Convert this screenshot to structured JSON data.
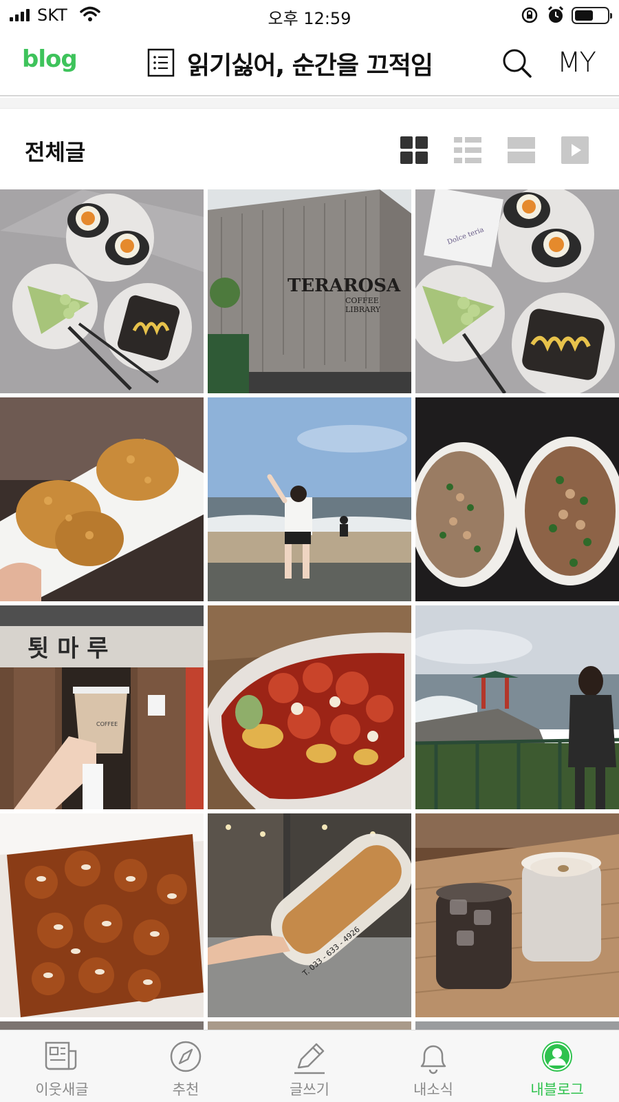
{
  "status_bar": {
    "carrier": "SKT",
    "time": "오후 12:59"
  },
  "header": {
    "logo": "blog",
    "title": "읽기싫어, 순간을 끄적임",
    "my_label": "MY"
  },
  "section": {
    "title": "전체글",
    "view_modes": [
      "grid",
      "list",
      "card",
      "video"
    ],
    "active_view": "grid"
  },
  "grid": {
    "tiles": [
      {
        "name": "photo-dessert-plates",
        "text": ""
      },
      {
        "name": "photo-terarosa-building",
        "text": "TERAROSA",
        "sub": "COFFEE LIBRARY"
      },
      {
        "name": "photo-dessert-plates-2",
        "text": ""
      },
      {
        "name": "photo-croquettes",
        "text": ""
      },
      {
        "name": "photo-beach-person",
        "text": ""
      },
      {
        "name": "photo-fried-rice-bowls",
        "text": ""
      },
      {
        "name": "photo-cafe-coffee-cup",
        "text": "툇 마 루",
        "sub": "COFFEE"
      },
      {
        "name": "photo-spicy-chicken-bowl",
        "text": ""
      },
      {
        "name": "photo-seaside-pavilion",
        "text": ""
      },
      {
        "name": "photo-fried-chicken-almonds",
        "text": ""
      },
      {
        "name": "photo-bread-package",
        "text": "T. 033 - 633 - 4926"
      },
      {
        "name": "photo-iced-drinks",
        "text": ""
      }
    ]
  },
  "tab_bar": {
    "items": [
      {
        "label": "이웃새글",
        "icon": "news-icon",
        "active": false
      },
      {
        "label": "추천",
        "icon": "compass-icon",
        "active": false
      },
      {
        "label": "글쓰기",
        "icon": "pencil-icon",
        "active": false
      },
      {
        "label": "내소식",
        "icon": "bell-icon",
        "active": false
      },
      {
        "label": "내블로그",
        "icon": "profile-icon",
        "active": true
      }
    ]
  },
  "colors": {
    "accent": "#2fc24e",
    "logo": "#3ec35b"
  }
}
